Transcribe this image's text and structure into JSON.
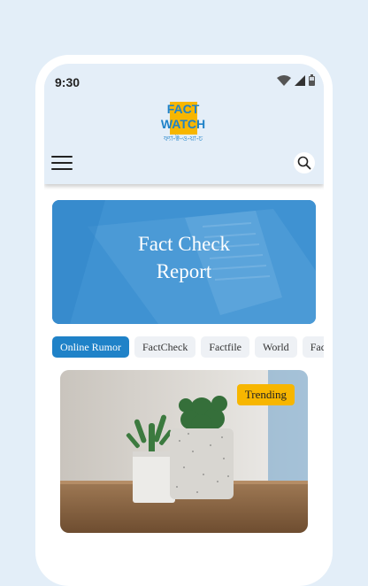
{
  "status_bar": {
    "time": "9:30"
  },
  "header": {
    "logo_line1": "FACT",
    "logo_line2": "WATCH",
    "logo_bangla": "ফ্যা-ক্ট-ও-য়া-চ"
  },
  "banner": {
    "title_line1": "Fact Check",
    "title_line2": "Report"
  },
  "categories": [
    {
      "label": "Online Rumor",
      "active": true
    },
    {
      "label": "FactCheck"
    },
    {
      "label": "Factfile"
    },
    {
      "label": "World"
    },
    {
      "label": "Fac"
    }
  ],
  "card": {
    "badge": "Trending"
  },
  "colors": {
    "accent": "#1f82c8",
    "badge": "#f7b600",
    "header_bg": "#e4eef8",
    "page_bg": "#e3eef8"
  }
}
